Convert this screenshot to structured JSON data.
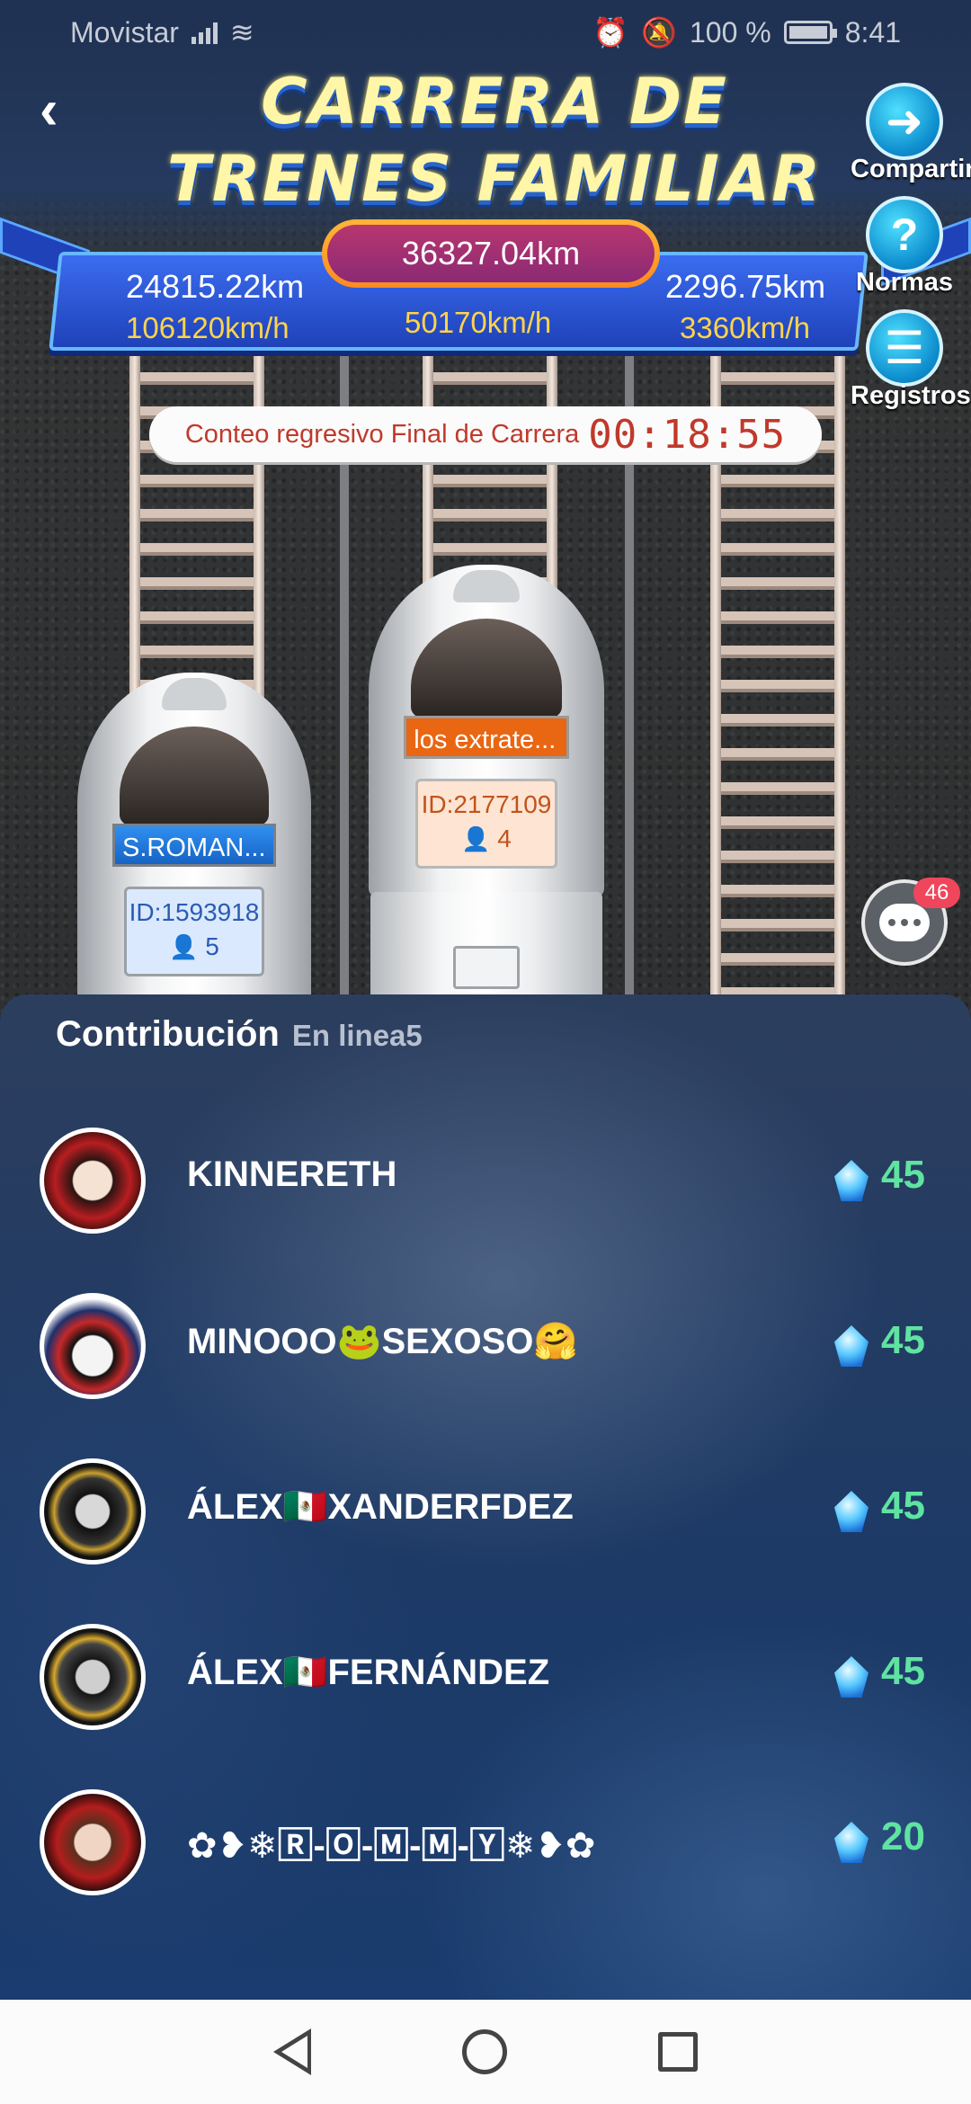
{
  "status_bar": {
    "carrier": "Movistar",
    "battery": "100 %",
    "time": "8:41"
  },
  "header": {
    "title_line1": "CARRERA DE",
    "title_line2": "TRENES FAMILIAR"
  },
  "side_buttons": {
    "share": "Compartir",
    "rules": "Normas",
    "records": "Registros"
  },
  "race": {
    "total_distance": "36327.04km",
    "left": {
      "distance": "24815.22km",
      "speed": "106120km/h"
    },
    "center": {
      "speed": "50170km/h"
    },
    "right": {
      "distance": "2296.75km",
      "speed": "3360km/h"
    },
    "countdown_label": "Conteo regresivo Final de Carrera",
    "countdown_time": "00:18:55"
  },
  "trains": [
    {
      "name": "S.ROMAN...",
      "id": "ID:1593918",
      "members": "5"
    },
    {
      "name": "los extrate...",
      "id": "ID:2177109",
      "members": "4"
    }
  ],
  "chat": {
    "badge": "46"
  },
  "contribution": {
    "title": "Contribución",
    "online": "En linea5",
    "users": [
      {
        "name": "KINNERETH",
        "score": "45"
      },
      {
        "name": "MINOOO🐸SEXOSO🤗",
        "score": "45"
      },
      {
        "name": "ÁLEX🇲🇽XANDERFDEZ",
        "score": "45"
      },
      {
        "name": "ÁLEX🇲🇽FERNÁNDEZ",
        "score": "45"
      },
      {
        "name": "✿❥❄🅁-🄾-🄼-🄼-🅈❄❥✿",
        "score": "20"
      }
    ]
  },
  "colors": {
    "title_yellow": "#fff6a8",
    "board_blue": "#2f56d6",
    "speed_yellow": "#ffd44a",
    "countdown_red": "#c0392b",
    "score_green": "#5fe3a1"
  },
  "icons": [
    "back-arrow-icon",
    "share-arrow-icon",
    "question-icon",
    "records-icon",
    "chat-icon",
    "user-icon",
    "diamond-icon"
  ]
}
